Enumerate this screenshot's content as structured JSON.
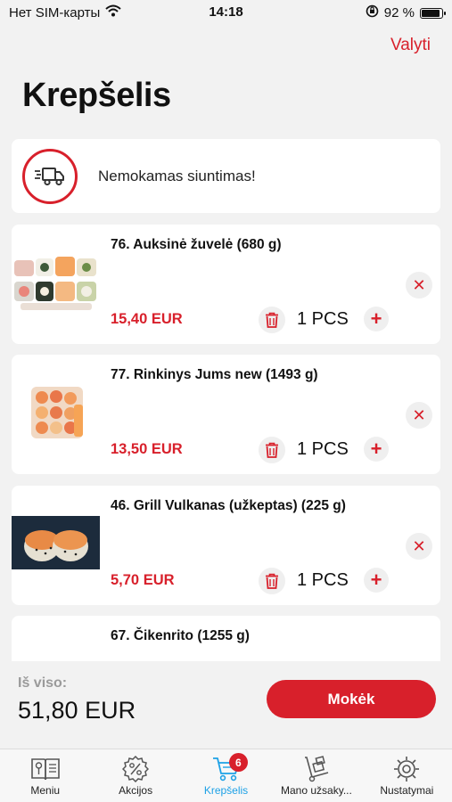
{
  "status_bar": {
    "carrier": "Нет SIM-карты",
    "time": "14:18",
    "battery": "92 %",
    "battery_level": 0.92
  },
  "header": {
    "edit_label": "Valyti",
    "title": "Krepšelis"
  },
  "shipping": {
    "text": "Nemokamas siuntimas!"
  },
  "items": [
    {
      "title": "76. Auksinė žuvelė (680 g)",
      "price": "15,40 EUR",
      "qty": "1 PCS"
    },
    {
      "title": "77. Rinkinys Jums new (1493 g)",
      "price": "13,50 EUR",
      "qty": "1 PCS"
    },
    {
      "title": "46. Grill Vulkanas (užkeptas) (225 g)",
      "price": "5,70 EUR",
      "qty": "1 PCS"
    },
    {
      "title": "67. Čikenrito (1255 g)"
    }
  ],
  "footer": {
    "total_label": "Iš viso:",
    "total_value": "51,80 EUR",
    "pay_label": "Mokėk"
  },
  "tabs": [
    {
      "label": "Meniu",
      "icon": "menu-book-icon"
    },
    {
      "label": "Akcijos",
      "icon": "discount-badge-icon"
    },
    {
      "label": "Krepšelis",
      "icon": "cart-icon",
      "badge": "6",
      "active": true
    },
    {
      "label": "Mano užsaky...",
      "icon": "hand-truck-icon"
    },
    {
      "label": "Nustatymai",
      "icon": "gear-icon"
    }
  ],
  "colors": {
    "accent": "#d8202b",
    "active_tab": "#1da1e6",
    "background": "#f2f2f2"
  }
}
